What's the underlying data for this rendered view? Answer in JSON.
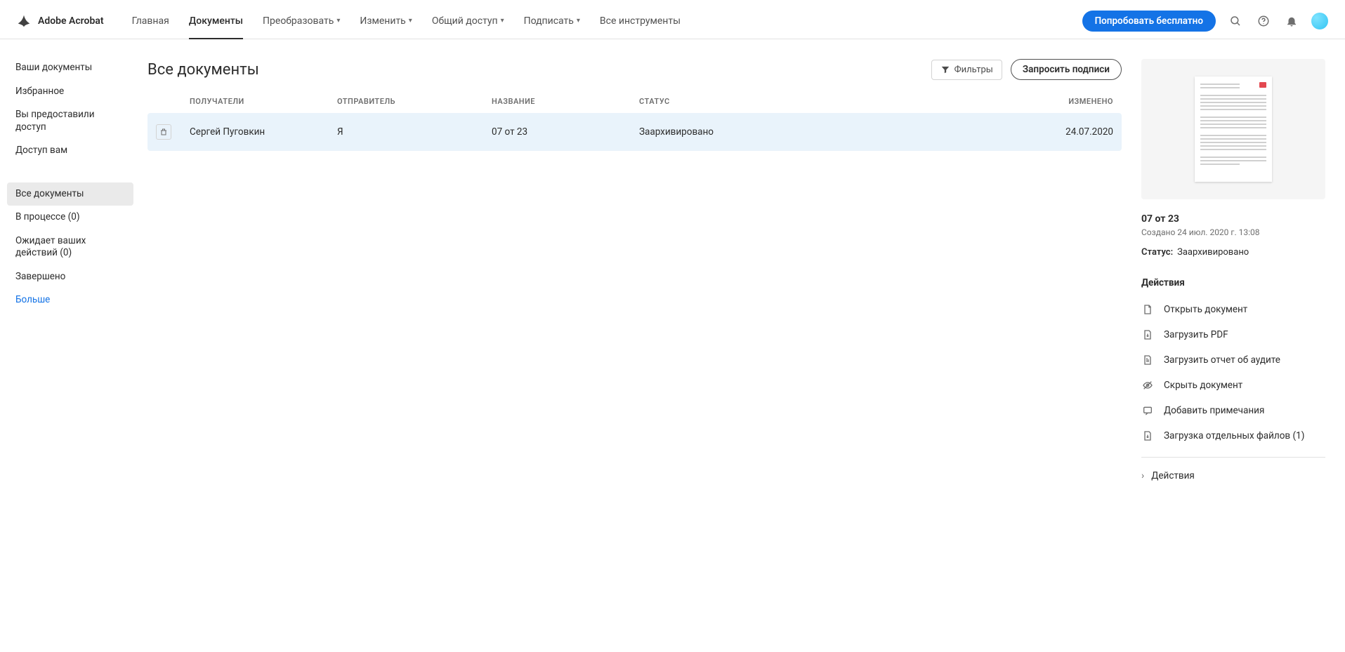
{
  "app_name": "Adobe Acrobat",
  "nav": {
    "home": "Главная",
    "documents": "Документы",
    "convert": "Преобразовать",
    "edit": "Изменить",
    "share": "Общий доступ",
    "sign": "Подписать",
    "all_tools": "Все инструменты"
  },
  "cta": "Попробовать бесплатно",
  "sidebar": {
    "group1": {
      "your_docs": "Ваши документы",
      "favorites": "Избранное",
      "you_shared": "Вы предоставили доступ",
      "shared_with_you": "Доступ вам"
    },
    "group2": {
      "all_docs": "Все документы",
      "in_progress": "В процессе (0)",
      "awaiting": "Ожидает ваших действий (0)",
      "completed": "Завершено",
      "more": "Больше"
    }
  },
  "page": {
    "title": "Все документы",
    "filters_btn": "Фильтры",
    "request_btn": "Запросить подписи"
  },
  "table": {
    "headers": {
      "recipients": "ПОЛУЧАТЕЛИ",
      "sender": "ОТПРАВИТЕЛЬ",
      "title": "НАЗВАНИЕ",
      "status": "СТАТУС",
      "changed": "ИЗМЕНЕНО"
    },
    "rows": [
      {
        "recipients": "Сергей Пуговкин",
        "sender": "Я",
        "title": "07 от 23",
        "status": "Заархивировано",
        "changed": "24.07.2020"
      }
    ]
  },
  "details": {
    "title": "07 от 23",
    "created": "Создано 24 июл. 2020 г. 13:08",
    "status_label": "Статус:",
    "status_value": "Заархивировано",
    "actions_label": "Действия",
    "actions": {
      "open": "Открыть документ",
      "download_pdf": "Загрузить PDF",
      "download_audit": "Загрузить отчет об аудите",
      "hide": "Скрыть документ",
      "notes": "Добавить примечания",
      "download_files": "Загрузка отдельных файлов (1)"
    },
    "expand_actions": "Действия"
  }
}
